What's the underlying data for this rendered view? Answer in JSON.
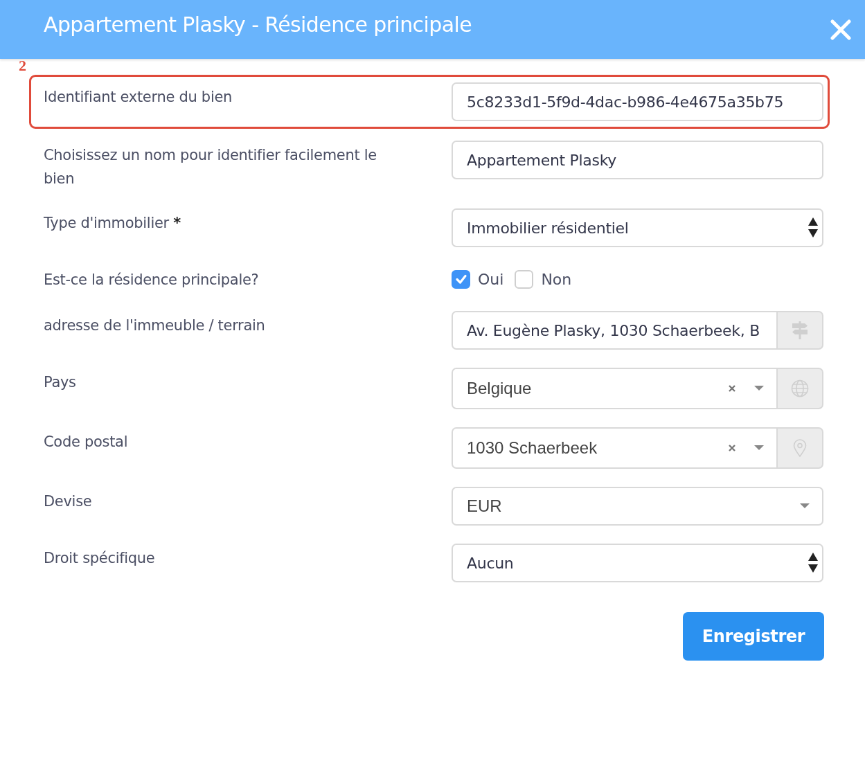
{
  "dialog": {
    "title": "Appartement Plasky - Résidence principale"
  },
  "fields": [
    {
      "kind": "text",
      "label": "Identifiant externe du bien",
      "value": "5c8233d1-5f9d-4dac-b986-4e4675a35b75",
      "highlighted": true,
      "annotation": "2"
    },
    {
      "kind": "text",
      "label": "Choisissez un nom pour identifier facilement le bien",
      "value": "Appartement Plasky"
    },
    {
      "kind": "select",
      "label": "Type d'immobilier",
      "required_mark": "*",
      "value": "Immobilier résidentiel"
    },
    {
      "kind": "choice",
      "label": "Est-ce la résidence principale?",
      "options": [
        {
          "label": "Oui",
          "checked": true
        },
        {
          "label": "Non",
          "checked": false
        }
      ]
    },
    {
      "kind": "addon_text",
      "label": "adresse de l'immeuble / terrain",
      "value": "Av. Eugène Plasky, 1030 Schaerbeek, B",
      "addon": {
        "kind": "signpost"
      }
    },
    {
      "kind": "combo",
      "label": "Pays",
      "value": "Belgique",
      "addon": {
        "kind": "globe"
      }
    },
    {
      "kind": "combo",
      "label": "Code postal",
      "value": "1030 Schaerbeek",
      "addon": {
        "kind": "pin"
      }
    },
    {
      "kind": "dropdown",
      "label": "Devise",
      "value": "EUR"
    },
    {
      "kind": "select",
      "label": "Droit spécifique",
      "value": "Aucun"
    }
  ],
  "save_button": {
    "label": "Enregistrer"
  }
}
